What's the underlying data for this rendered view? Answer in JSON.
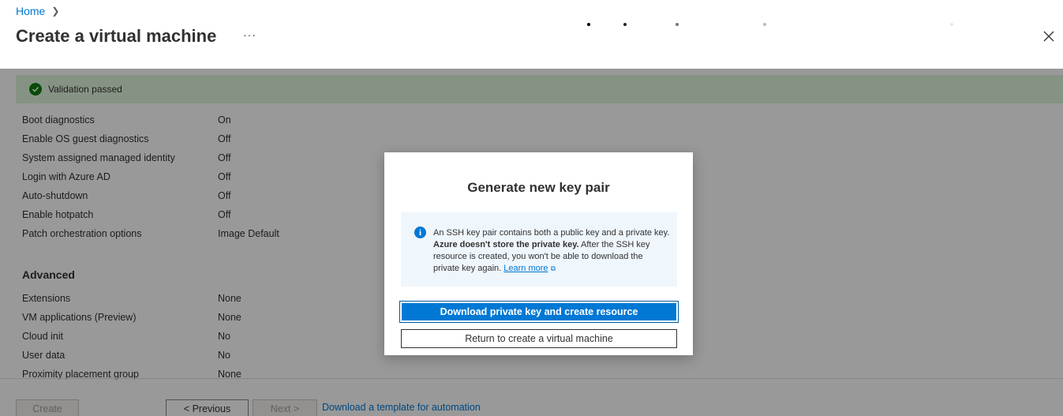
{
  "breadcrumb": {
    "home": "Home"
  },
  "header": {
    "title": "Create a virtual machine",
    "more": "···"
  },
  "validation": {
    "text": "Validation passed"
  },
  "settings": [
    {
      "label": "Boot diagnostics",
      "value": "On"
    },
    {
      "label": "Enable OS guest diagnostics",
      "value": "Off"
    },
    {
      "label": "System assigned managed identity",
      "value": "Off"
    },
    {
      "label": "Login with Azure AD",
      "value": "Off"
    },
    {
      "label": "Auto-shutdown",
      "value": "Off"
    },
    {
      "label": "Enable hotpatch",
      "value": "Off"
    },
    {
      "label": "Patch orchestration options",
      "value": "Image Default"
    }
  ],
  "advanced": {
    "title": "Advanced",
    "items": [
      {
        "label": "Extensions",
        "value": "None"
      },
      {
        "label": "VM applications (Preview)",
        "value": "None"
      },
      {
        "label": "Cloud init",
        "value": "No"
      },
      {
        "label": "User data",
        "value": "No"
      },
      {
        "label": "Proximity placement group",
        "value": "None"
      }
    ]
  },
  "footer": {
    "create": "Create",
    "previous": "< Previous",
    "next": "Next >",
    "template_link": "Download a template for automation"
  },
  "dialog": {
    "title": "Generate new key pair",
    "info_pre": "An SSH key pair contains both a public key and a private key. ",
    "info_bold": "Azure doesn't store the private key.",
    "info_post": " After the SSH key resource is created, you won't be able to download the private key again. ",
    "learn_more": "Learn more",
    "primary_button": "Download private key and create resource",
    "secondary_button": "Return to create a virtual machine"
  },
  "colors": {
    "accent": "#0078d4",
    "success": "#107c10",
    "info_bg": "#eff6fc"
  }
}
